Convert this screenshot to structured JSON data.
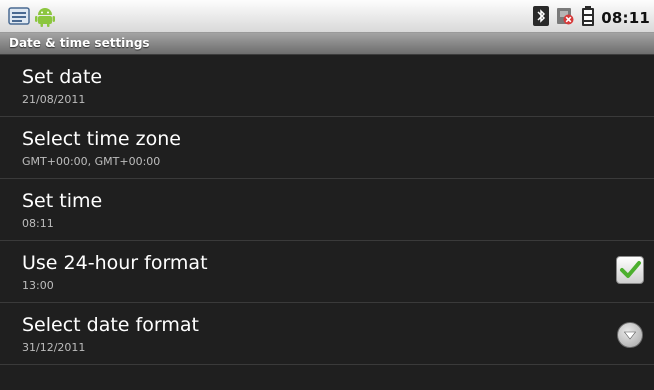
{
  "status_bar": {
    "time": "08:11",
    "left_icons": [
      "notification-list-icon",
      "android-icon"
    ],
    "right_icons": [
      "bluetooth-icon",
      "no-sim-icon",
      "battery-icon"
    ]
  },
  "header": {
    "title": "Date & time settings"
  },
  "settings": [
    {
      "title": "Set date",
      "summary": "21/08/2011"
    },
    {
      "title": "Select time zone",
      "summary": "GMT+00:00, GMT+00:00"
    },
    {
      "title": "Set time",
      "summary": "08:11"
    },
    {
      "title": "Use 24-hour format",
      "summary": "13:00",
      "checked": true
    },
    {
      "title": "Select date format",
      "summary": "31/12/2011"
    }
  ],
  "colors": {
    "background": "#1f1f1f",
    "check_green": "#4caf2e",
    "title_bar": "#8a8a8a"
  }
}
